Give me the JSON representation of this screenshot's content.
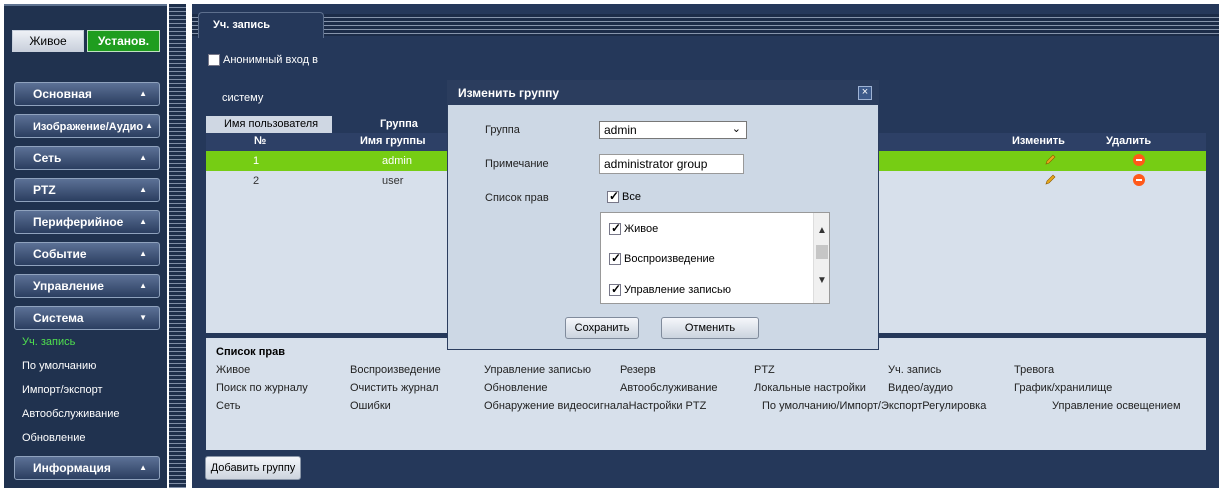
{
  "top_buttons": {
    "live": "Живое",
    "setup": "Установ."
  },
  "menu": [
    {
      "label": "Основная",
      "arrow": "▲"
    },
    {
      "label": "Изображение/Аудио",
      "arrow": "▲"
    },
    {
      "label": "Сеть",
      "arrow": "▲"
    },
    {
      "label": "PTZ",
      "arrow": "▲"
    },
    {
      "label": "Периферийное",
      "arrow": "▲"
    },
    {
      "label": "Событие",
      "arrow": "▲"
    },
    {
      "label": "Управление",
      "arrow": "▲"
    },
    {
      "label": "Система",
      "arrow": "▼"
    },
    {
      "label": "Информация",
      "arrow": "▲"
    }
  ],
  "submenu": [
    "Уч. запись",
    "По умолчанию",
    "Импорт/экспорт",
    "Автообслуживание",
    "Обновление"
  ],
  "main": {
    "tab": "Уч. запись",
    "anon_line1": "Анонимный вход в",
    "anon_line2": "систему",
    "subtabs": {
      "user": "Имя пользователя",
      "group": "Группа"
    },
    "table": {
      "headers": {
        "no": "№",
        "name": "Имя группы",
        "edit": "Изменить",
        "delete": "Удалить"
      },
      "rows": [
        {
          "no": "1",
          "name": "admin"
        },
        {
          "no": "2",
          "name": "user"
        }
      ]
    },
    "rights": {
      "title": "Список прав",
      "row1": [
        "Живое",
        "Воспроизведение",
        "Управление записью",
        "Резерв",
        "PTZ",
        "Уч. запись",
        "Тревога"
      ],
      "row2": [
        "Поиск по журналу",
        "Очистить журнал",
        "Обновление",
        "Автообслуживание",
        "Локальные настройки",
        "Видео/аудио",
        "График/хранилище"
      ],
      "row3": [
        "Сеть",
        "Ошибки",
        "Обнаружение видеосигналаНастройки PTZ",
        "По умолчанию/Импорт/ЭкспортРегулировка",
        "Управление освещением"
      ]
    },
    "add_group": "Добавить группу"
  },
  "modal": {
    "title": "Изменить группу",
    "close": "×",
    "group_label": "Группа",
    "group_value": "admin",
    "note_label": "Примечание",
    "note_value": "administrator group",
    "rights_label": "Список прав",
    "all_label": "Все",
    "perms": [
      "Живое",
      "Воспроизведение",
      "Управление записью"
    ],
    "save": "Сохранить",
    "cancel": "Отменить"
  },
  "colors": {
    "accent_green": "#76cd14",
    "panel_dark": "#25385a",
    "delete_orange": "#ff5a1a"
  }
}
